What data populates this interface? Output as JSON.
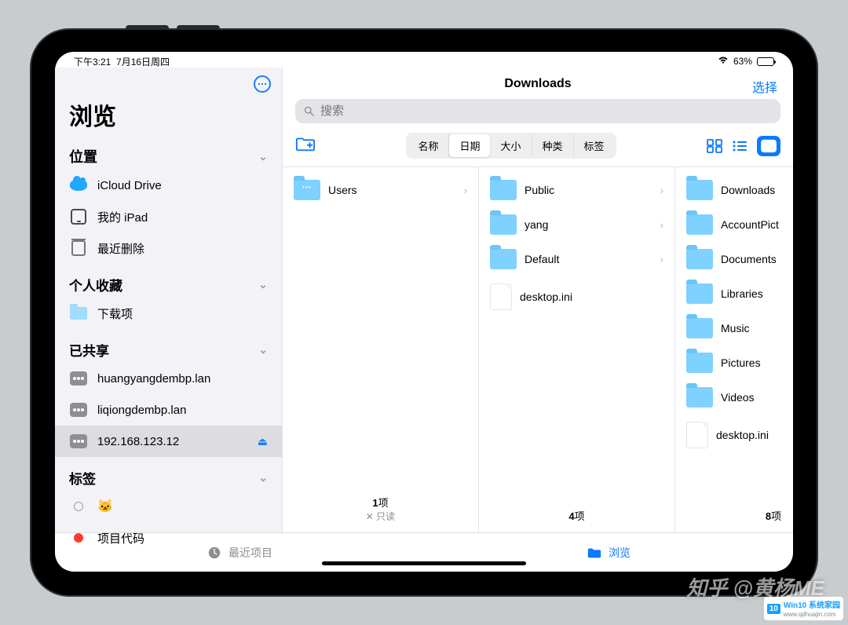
{
  "status": {
    "time": "下午3:21",
    "date": "7月16日周四",
    "battery_pct": "63%"
  },
  "sidebar": {
    "title": "浏览",
    "sections": {
      "locations": {
        "header": "位置",
        "items": [
          "iCloud Drive",
          "我的 iPad",
          "最近删除"
        ]
      },
      "favorites": {
        "header": "个人收藏",
        "items": [
          "下载项"
        ]
      },
      "shared": {
        "header": "已共享",
        "items": [
          "huangyangdembp.lan",
          "liqiongdembp.lan",
          "192.168.123.12"
        ]
      },
      "tags": {
        "header": "标签",
        "items": [
          "🐱",
          "项目代码"
        ]
      }
    }
  },
  "main": {
    "title": "Downloads",
    "select_label": "选择",
    "search_placeholder": "搜索",
    "sort": {
      "options": [
        "名称",
        "日期",
        "大小",
        "种类",
        "标签"
      ],
      "active_index": 1
    },
    "columns": [
      {
        "items": [
          {
            "name": "Users",
            "type": "folder-users",
            "chevron": true
          }
        ],
        "footer_count": "1项",
        "footer_readonly": "只读"
      },
      {
        "items": [
          {
            "name": "Public",
            "type": "folder",
            "chevron": true
          },
          {
            "name": "yang",
            "type": "folder",
            "chevron": true
          },
          {
            "name": "Default",
            "type": "folder",
            "chevron": true
          },
          {
            "name": "desktop.ini",
            "type": "file",
            "chevron": false
          }
        ],
        "footer_count": "4项"
      },
      {
        "items": [
          {
            "name": "Downloads",
            "type": "folder",
            "chevron": false
          },
          {
            "name": "AccountPict",
            "type": "folder",
            "chevron": false
          },
          {
            "name": "Documents",
            "type": "folder",
            "chevron": false
          },
          {
            "name": "Libraries",
            "type": "folder",
            "chevron": false
          },
          {
            "name": "Music",
            "type": "folder",
            "chevron": false
          },
          {
            "name": "Pictures",
            "type": "folder",
            "chevron": false
          },
          {
            "name": "Videos",
            "type": "folder",
            "chevron": false
          },
          {
            "name": "desktop.ini",
            "type": "file",
            "chevron": false
          }
        ],
        "footer_count": "8项"
      }
    ]
  },
  "tabbar": {
    "recent": "最近项目",
    "browse": "浏览"
  },
  "watermark": {
    "zhihu": "知乎 @黄杨ME",
    "win10_badge": "10",
    "win10_text": "Win10 系统家园",
    "win10_url": "www.qdhuajin.com"
  }
}
